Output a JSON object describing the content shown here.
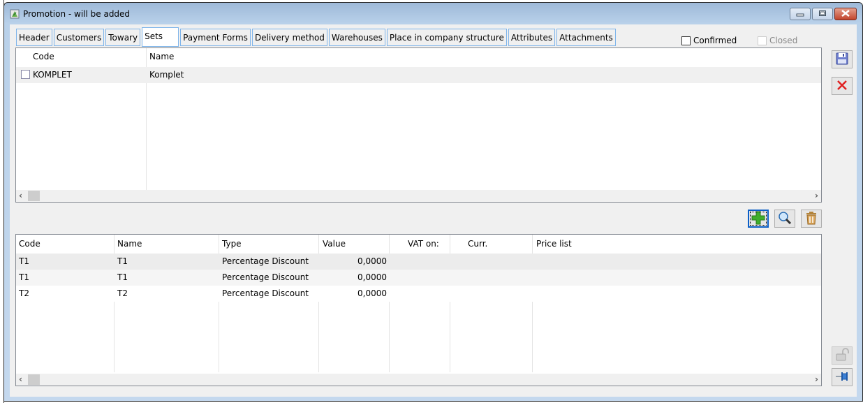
{
  "window": {
    "title": "Promotion - will be added",
    "controls": {
      "minimize": "minimize-icon",
      "maximize": "maximize-icon",
      "close": "close-icon"
    }
  },
  "tabs": [
    {
      "label": "Header",
      "active": false
    },
    {
      "label": "Customers",
      "active": false
    },
    {
      "label": "Towary",
      "active": false
    },
    {
      "label": "Sets",
      "active": true
    },
    {
      "label": "Payment Forms",
      "active": false
    },
    {
      "label": "Delivery method",
      "active": false
    },
    {
      "label": "Warehouses",
      "active": false
    },
    {
      "label": "Place in company structure",
      "active": false
    },
    {
      "label": "Attributes",
      "active": false
    },
    {
      "label": "Attachments",
      "active": false
    }
  ],
  "flags": {
    "confirmed": {
      "label": "Confirmed",
      "checked": false,
      "enabled": true
    },
    "closed": {
      "label": "Closed",
      "checked": false,
      "enabled": false
    }
  },
  "sets_grid": {
    "columns": [
      "Code",
      "Name"
    ],
    "rows": [
      {
        "checked": false,
        "code": "KOMPLET",
        "name": "Komplet"
      }
    ]
  },
  "items_toolbar": {
    "add": "add-icon",
    "search": "search-icon",
    "delete": "trash-icon"
  },
  "items_grid": {
    "columns": [
      "Code",
      "Name",
      "Type",
      "Value",
      "VAT on:",
      "Curr.",
      "Price list"
    ],
    "rows": [
      {
        "code": "T1",
        "name": "T1",
        "type": "Percentage Discount",
        "value": "0,0000",
        "vat_on": "",
        "curr": "",
        "price_list": ""
      },
      {
        "code": "T1",
        "name": "T1",
        "type": "Percentage Discount",
        "value": "0,0000",
        "vat_on": "",
        "curr": "",
        "price_list": ""
      },
      {
        "code": "T2",
        "name": "T2",
        "type": "Percentage Discount",
        "value": "0,0000",
        "vat_on": "",
        "curr": "",
        "price_list": ""
      }
    ]
  },
  "side_toolbar": {
    "save": "save-icon",
    "cancel": "cancel-icon",
    "lock": "unlock-icon",
    "pin": "pin-icon"
  },
  "colors": {
    "tab_border": "#7eb4ea",
    "row_alt": "#f0f0f0",
    "focus_border": "#0b5fc7",
    "add_green": "#3fae2a",
    "cancel_red": "#e02020"
  }
}
